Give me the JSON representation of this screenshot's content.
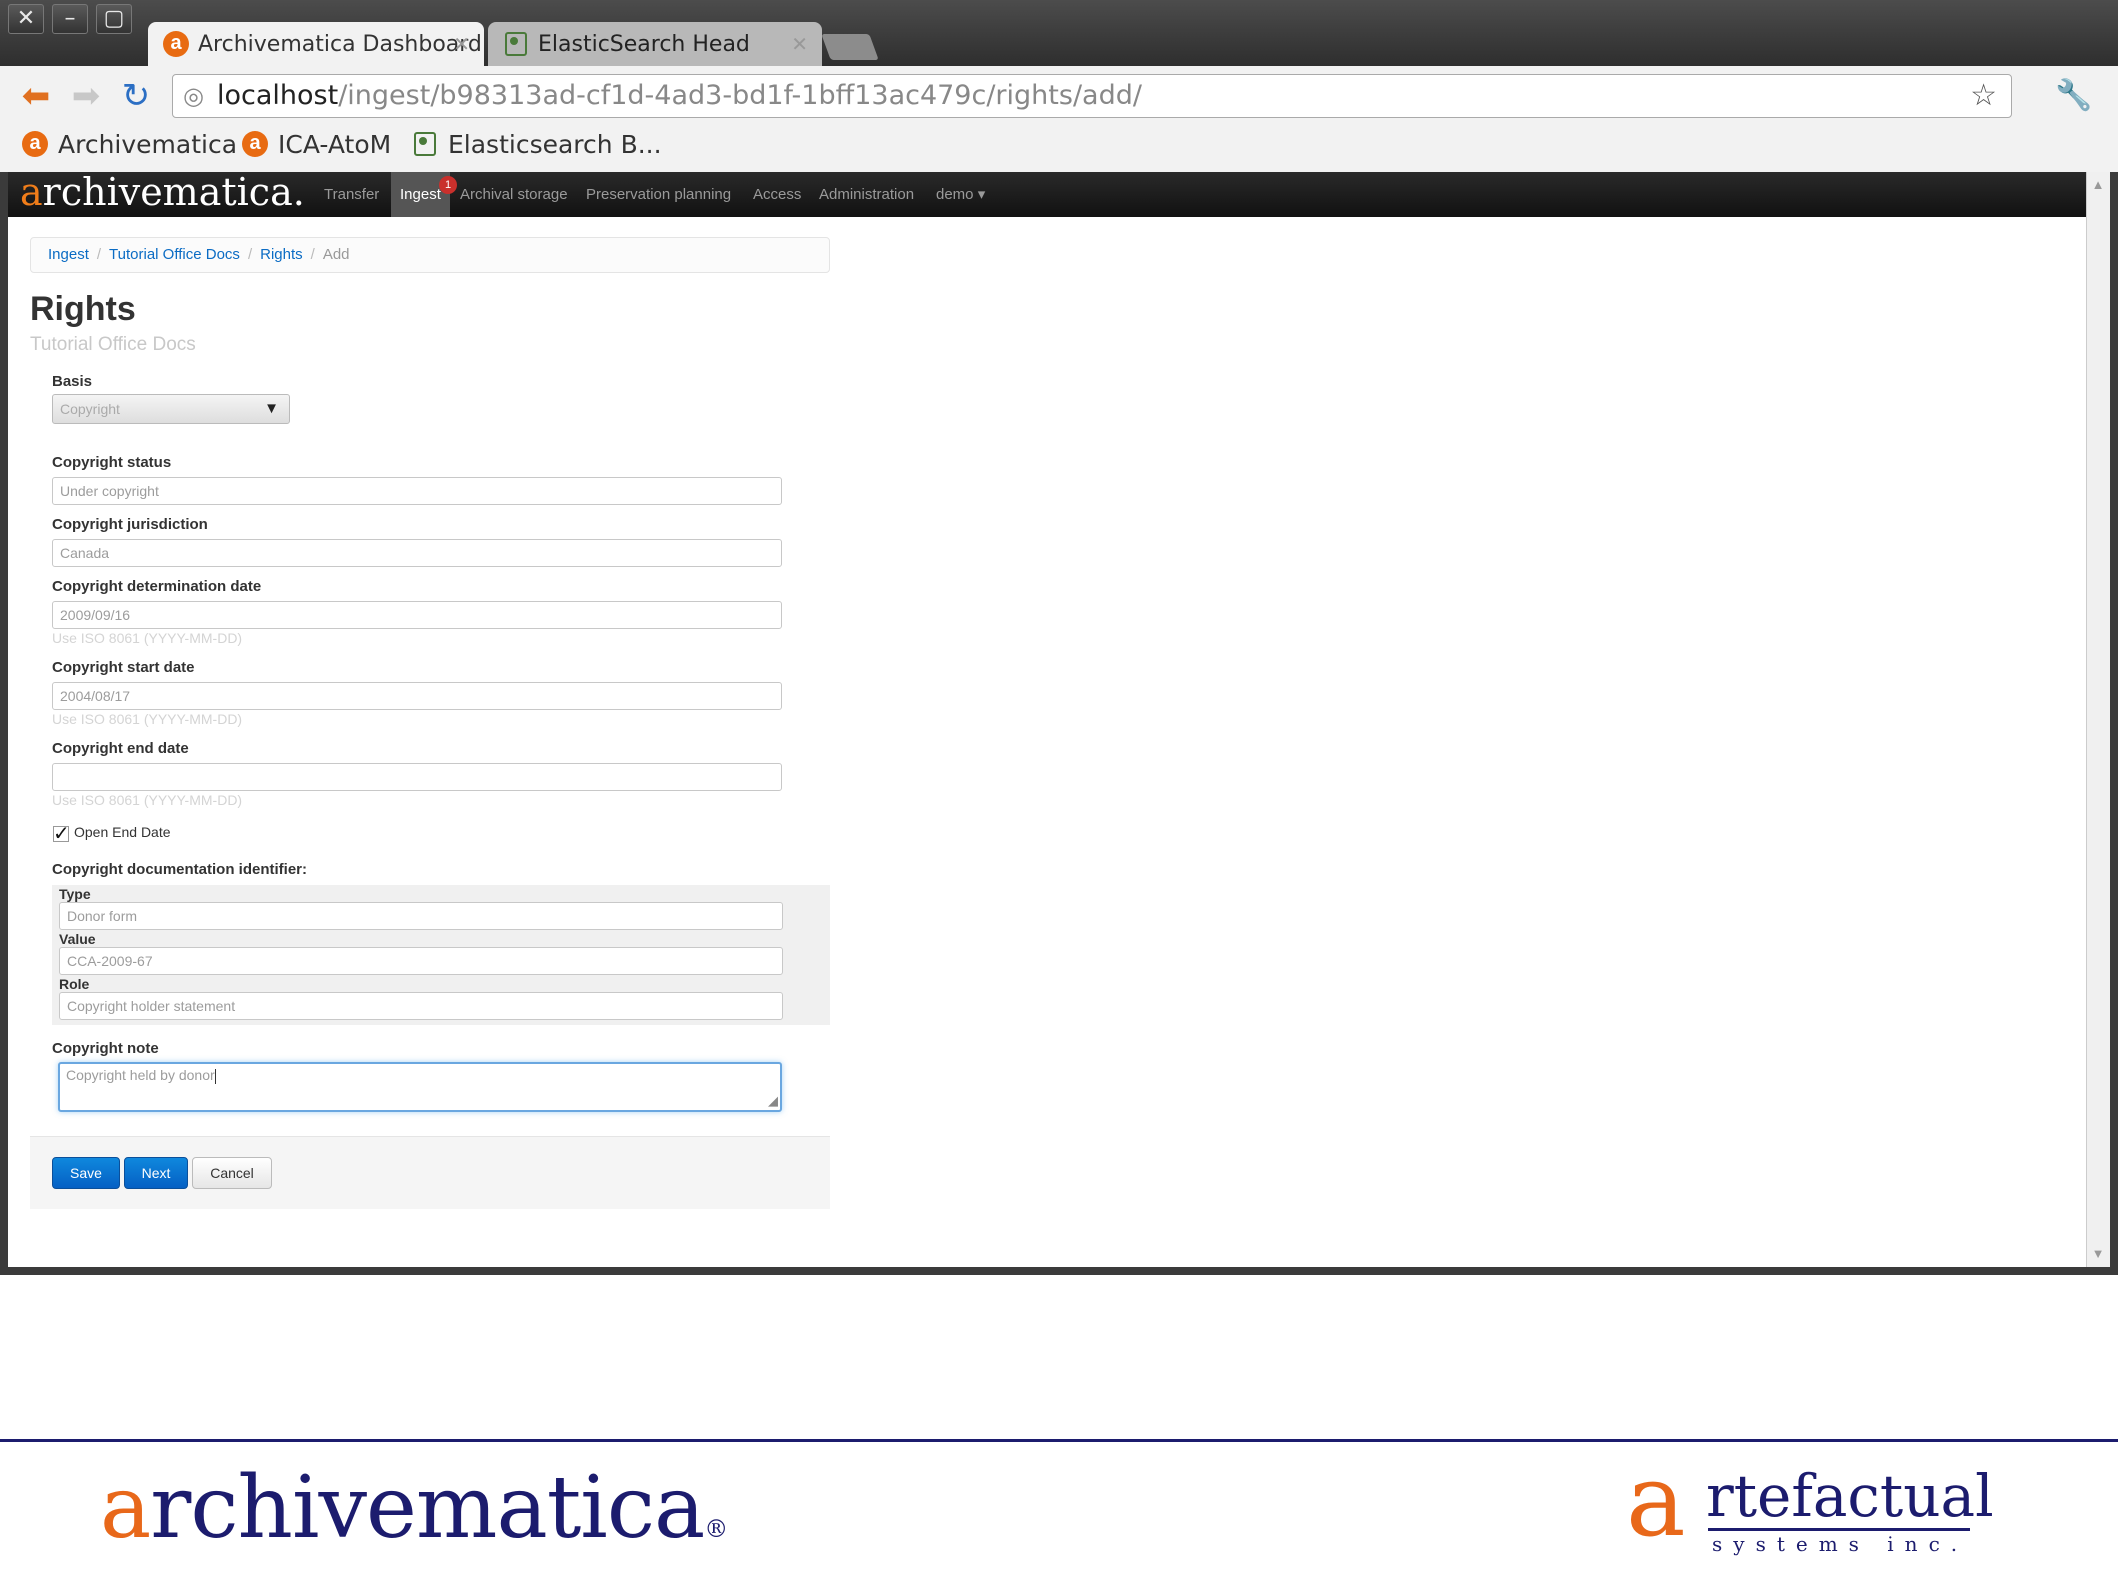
{
  "browser": {
    "tabs": [
      {
        "label": "Archivematica Dashboard",
        "icon": "archivematica-favicon"
      },
      {
        "label": "ElasticSearch Head",
        "icon": "elasticsearch-favicon"
      }
    ],
    "url_host": "localhost",
    "url_path": "/ingest/b98313ad-cf1d-4ad3-bd1f-1bff13ac479c/rights/add/",
    "bookmarks": [
      {
        "label": "Archivematica",
        "icon": "archivematica-favicon"
      },
      {
        "label": "ICA-AtoM",
        "icon": "archivematica-favicon"
      },
      {
        "label": "Elasticsearch B...",
        "icon": "elasticsearch-favicon"
      }
    ]
  },
  "navbar": {
    "logo_a": "a",
    "logo_rest": "rchivematica",
    "logo_dot": ".",
    "items": [
      "Transfer",
      "Ingest",
      "Archival storage",
      "Preservation planning",
      "Access",
      "Administration",
      "demo"
    ],
    "ingest_badge": "1",
    "user_caret": "▾"
  },
  "breadcrumb": {
    "items": [
      "Ingest",
      "Tutorial Office Docs",
      "Rights"
    ],
    "current": "Add",
    "separator": "/"
  },
  "page": {
    "title": "Rights",
    "subtitle": "Tutorial Office Docs"
  },
  "form": {
    "basis_label": "Basis",
    "basis_value": "Copyright",
    "copyright_status_label": "Copyright status",
    "copyright_status_value": "Under copyright",
    "jurisdiction_label": "Copyright jurisdiction",
    "jurisdiction_value": "Canada",
    "determination_date_label": "Copyright determination date",
    "determination_date_value": "2009/09/16",
    "start_date_label": "Copyright start date",
    "start_date_value": "2004/08/17",
    "end_date_label": "Copyright end date",
    "end_date_value": "",
    "date_help": "Use ISO 8061 (YYYY-MM-DD)",
    "open_end_date_label": "Open End Date",
    "open_end_date_checked": true,
    "doc_identifier_label": "Copyright documentation identifier:",
    "doc_type_label": "Type",
    "doc_type_value": "Donor form",
    "doc_value_label": "Value",
    "doc_value_value": "CCA-2009-67",
    "doc_role_label": "Role",
    "doc_role_value": "Copyright holder statement",
    "note_label": "Copyright note",
    "note_value": "Copyright held by donor"
  },
  "actions": {
    "save": "Save",
    "next": "Next",
    "cancel": "Cancel"
  },
  "footer": {
    "archivematica_a": "a",
    "archivematica_rest": "rchivematica",
    "archivematica_reg": "®",
    "artefactual_a": "a",
    "artefactual_rest": "rtefactual",
    "artefactual_sub": "systems inc."
  },
  "colors": {
    "accent_orange": "#e8681a",
    "brand_navy": "#1c1c6e",
    "primary_button": "#0560c4",
    "link": "#0b6cc4"
  }
}
